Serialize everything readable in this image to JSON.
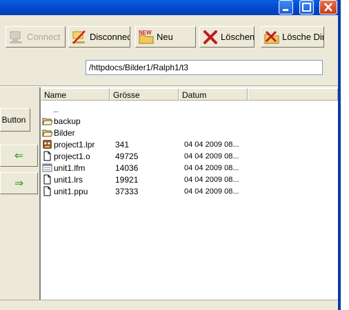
{
  "toolbar": {
    "connect_label": "Connect",
    "disconnect_label": "Disconnect",
    "new_label": "Neu",
    "delete_label": "Löschen",
    "delete_dir_label": "Lösche Dir"
  },
  "path": {
    "value": "/httpdocs/Bilder1/Ralph1/t3"
  },
  "side": {
    "button_label": "Button",
    "left_arrow": "⇐",
    "right_arrow": "⇒"
  },
  "list": {
    "columns": [
      "Name",
      "Grösse",
      "Datum"
    ],
    "rows": [
      {
        "icon": "parent-dir-icon",
        "name": "..",
        "size": "",
        "date": ""
      },
      {
        "icon": "folder-icon",
        "name": "backup",
        "size": "",
        "date": ""
      },
      {
        "icon": "folder-icon",
        "name": "Bilder",
        "size": "",
        "date": ""
      },
      {
        "icon": "lazarus-project-icon",
        "name": "project1.lpr",
        "size": "341",
        "date": "04 04 2009 08..."
      },
      {
        "icon": "file-icon",
        "name": "project1.o",
        "size": "49725",
        "date": "04 04 2009 08..."
      },
      {
        "icon": "form-file-icon",
        "name": "unit1.lfm",
        "size": "14036",
        "date": "04 04 2009 08..."
      },
      {
        "icon": "file-icon",
        "name": "unit1.lrs",
        "size": "19921",
        "date": "04 04 2009 08..."
      },
      {
        "icon": "file-icon",
        "name": "unit1.ppu",
        "size": "37333",
        "date": "04 04 2009 08..."
      }
    ]
  }
}
